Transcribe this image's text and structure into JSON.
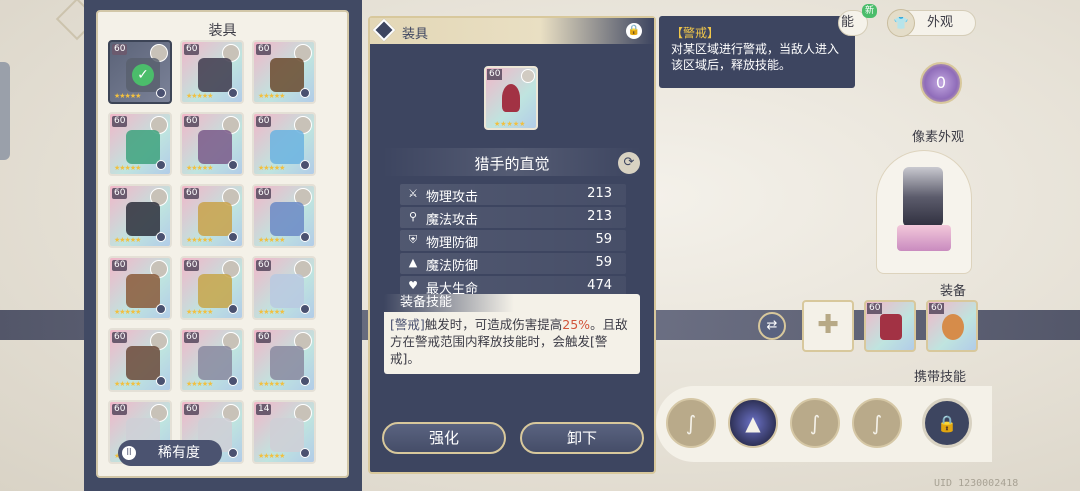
{
  "equip_panel": {
    "title": "装具",
    "rarity_button": "稀有度",
    "items": [
      {
        "level": "60",
        "selected": true
      },
      {
        "level": "60"
      },
      {
        "level": "60"
      },
      {
        "level": "60"
      },
      {
        "level": "60"
      },
      {
        "level": "60"
      },
      {
        "level": "60"
      },
      {
        "level": "60"
      },
      {
        "level": "60"
      },
      {
        "level": "60"
      },
      {
        "level": "60"
      },
      {
        "level": "60"
      },
      {
        "level": "60"
      },
      {
        "level": "60"
      },
      {
        "level": "60"
      },
      {
        "level": "60"
      },
      {
        "level": "60"
      },
      {
        "level": "14"
      }
    ]
  },
  "detail": {
    "header_title": "装具",
    "item_level": "60",
    "item_name": "猎手的直觉",
    "stats": [
      {
        "icon": "sword-icon",
        "label": "物理攻击",
        "value": "213"
      },
      {
        "icon": "wand-icon",
        "label": "魔法攻击",
        "value": "213"
      },
      {
        "icon": "shield-icon",
        "label": "物理防御",
        "value": "59"
      },
      {
        "icon": "hat-icon",
        "label": "魔法防御",
        "value": "59"
      },
      {
        "icon": "heart-icon",
        "label": "最大生命",
        "value": "474"
      }
    ],
    "skill_title": "装备技能",
    "skill_tag": "[警戒]",
    "skill_text_a": "触发时，可造成伤害提高",
    "skill_highlight": "25%",
    "skill_text_b": "。且敌方在警戒范围内释放技能时，会触发[警戒]。",
    "enhance_button": "强化",
    "unequip_button": "卸下"
  },
  "tooltip": {
    "title": "【警戒】",
    "body": "对某区域进行警戒，当敌人进入该区域后，释放技能。"
  },
  "right": {
    "tab_ability": "能",
    "tab_appearance": "外观",
    "new_badge": "新",
    "pixel_label": "像素外观",
    "equip_label": "装备",
    "carry_skill_label": "携带技能",
    "equip_levels": [
      "60",
      "60"
    ],
    "uid": "UID 1230002418"
  }
}
